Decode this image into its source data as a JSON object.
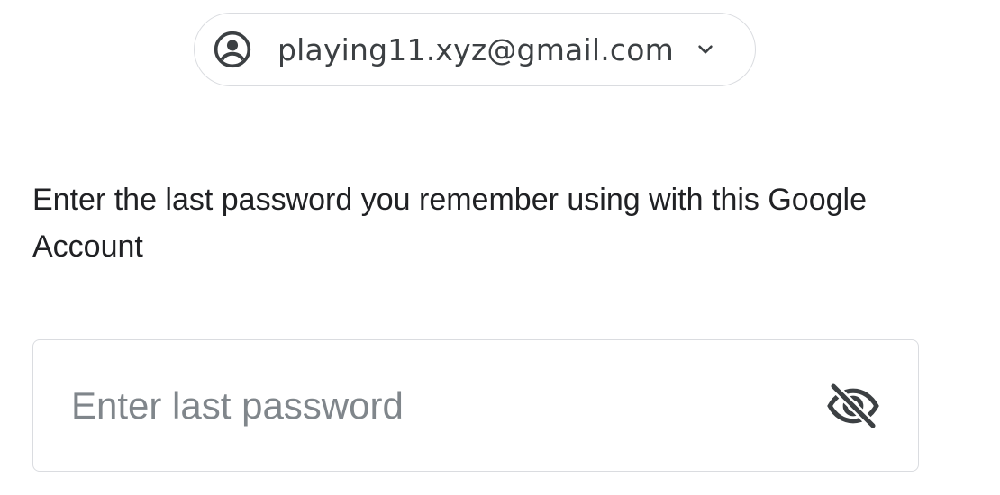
{
  "account": {
    "email": "playing11.xyz@gmail.com",
    "avatar_icon": "account-circle-icon",
    "expand_icon": "chevron-down-icon"
  },
  "instruction": {
    "text": "Enter the last password you remember using with this Google Account"
  },
  "password_field": {
    "value": "",
    "placeholder": "Enter last password",
    "toggle_icon": "visibility-off-icon"
  },
  "colors": {
    "border": "#dadce0",
    "text_primary": "#202124",
    "text_secondary": "#3c4043",
    "placeholder": "#80868b"
  }
}
